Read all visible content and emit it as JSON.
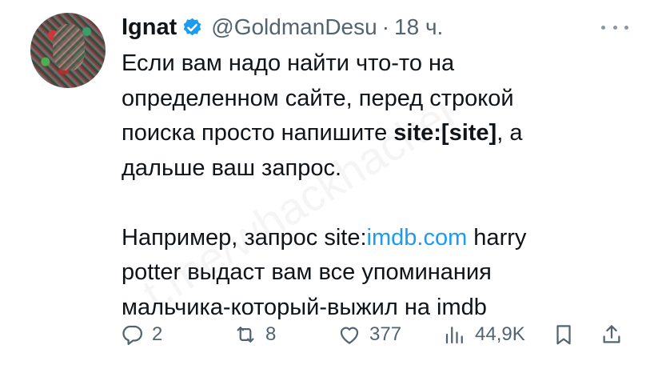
{
  "author": {
    "name": "Ignat",
    "handle": "@GoldmanDesu",
    "separator": "·",
    "time": "18 ч.",
    "verified": true
  },
  "tweet": {
    "p1_line1": "Если вам надо найти что-то на",
    "p1_line2": "определенном сайте, перед строкой",
    "p1_line3_pre": "поиска просто напишите ",
    "p1_line3_bold": "site:[site]",
    "p1_line3_post": ", а",
    "p1_line4": "дальше ваш запрос.",
    "p2_line1_pre": "Например, запрос site:",
    "p2_line1_link": "imdb.com",
    "p2_line1_post": " harry",
    "p2_line2": "potter выдаст вам все упоминания",
    "p2_line3": "мальчика-который-выжил на imdb"
  },
  "watermark": "t.me/whackhacker",
  "actions": {
    "replies": "2",
    "retweets": "8",
    "likes": "377",
    "views": "44,9K"
  },
  "colors": {
    "text": "#0f1419",
    "secondary": "#536471",
    "link": "#1d9bf0",
    "verified": "#1d9bf0"
  },
  "icons": [
    "more-icon",
    "verified-icon",
    "reply-icon",
    "retweet-icon",
    "like-icon",
    "views-icon",
    "bookmark-icon",
    "share-icon"
  ]
}
